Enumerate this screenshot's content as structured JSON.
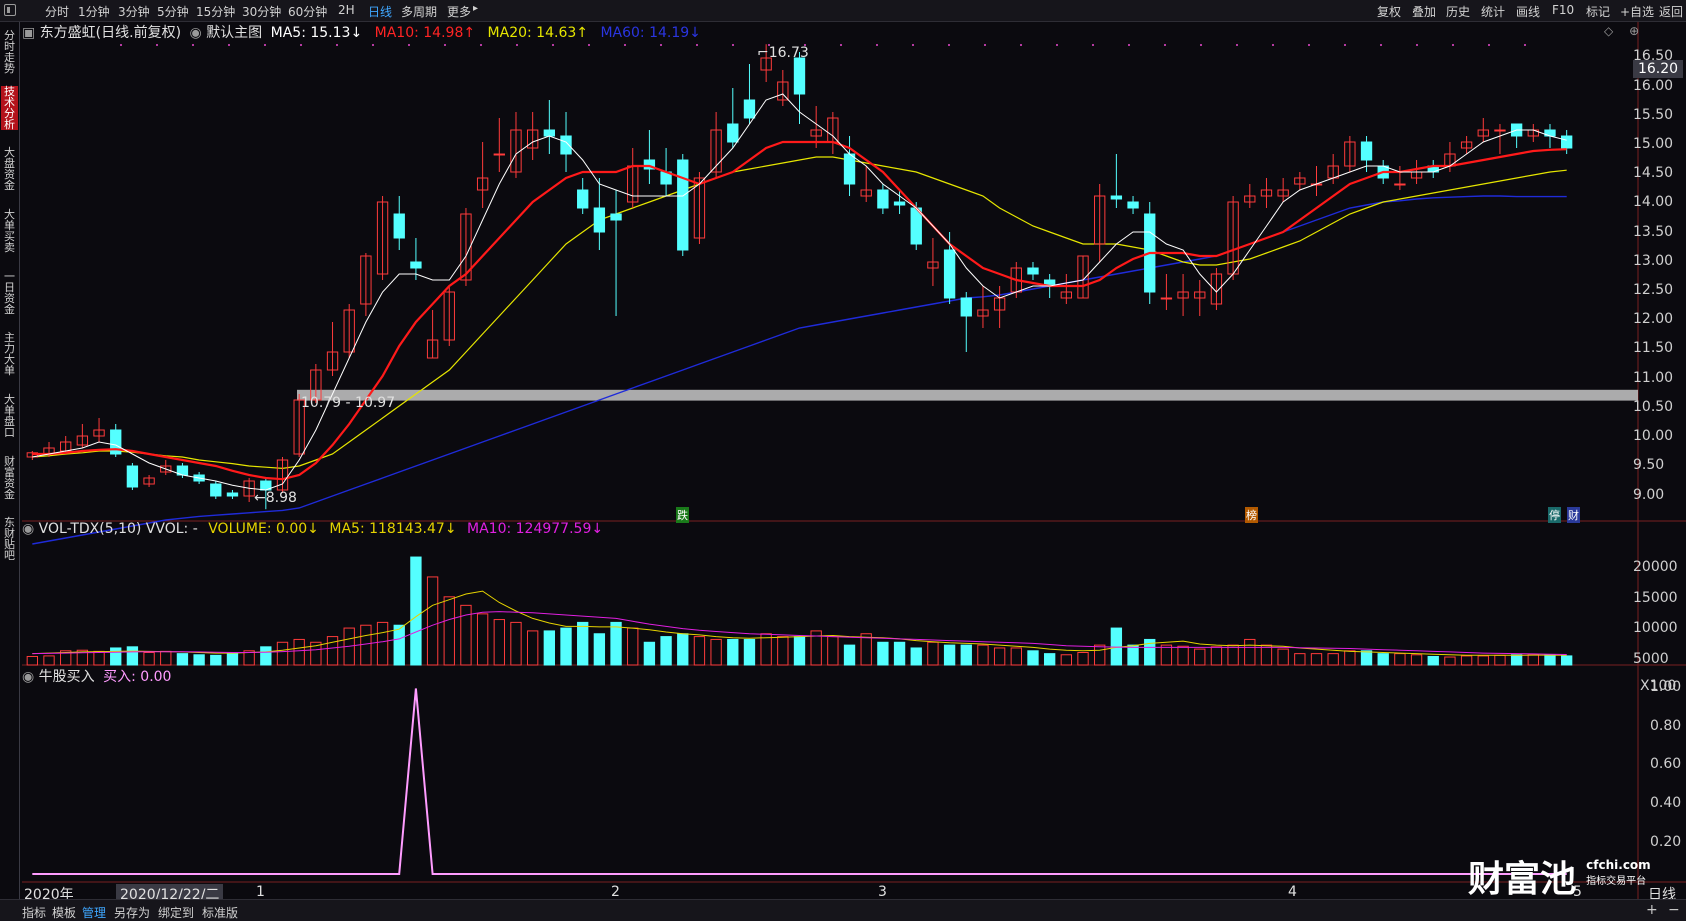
{
  "toolbar": {
    "timeframes": [
      "分时",
      "1分钟",
      "3分钟",
      "5分钟",
      "15分钟",
      "30分钟",
      "60分钟",
      "2H",
      "日线",
      "多周期",
      "更多"
    ],
    "active": "日线",
    "right": [
      "复权",
      "叠加",
      "历史",
      "统计",
      "画线",
      "F10",
      "标记",
      "+自选",
      "返回"
    ]
  },
  "sidebar": [
    {
      "label": "分时走势",
      "active": false
    },
    {
      "label": "技术分析",
      "active": true
    },
    {
      "label": "大盘资金",
      "active": false
    },
    {
      "label": "大单买卖",
      "active": false
    },
    {
      "label": "一日资金",
      "active": false
    },
    {
      "label": "主力大单",
      "active": false
    },
    {
      "label": "大单盘口",
      "active": false
    },
    {
      "label": "财富资金",
      "active": false
    },
    {
      "label": "东财贴吧",
      "active": false
    }
  ],
  "main_header": {
    "stock": "东方盛虹(日线.前复权)",
    "template": "默认主图",
    "ma5": "MA5: 15.13↓",
    "ma10": "MA10: 14.98↑",
    "ma20": "MA20: 14.63↑",
    "ma60": "MA60: 14.19↓"
  },
  "vol_header": {
    "name": "VOL-TDX(5,10) VVOL: -",
    "volume": "VOLUME: 0.00↓",
    "ma5": "MA5: 118143.47↓",
    "ma10": "MA10: 124977.59↓"
  },
  "ind_header": {
    "name": "牛股买入",
    "buy": "买入: 0.00"
  },
  "annotations": {
    "high": "16.73",
    "low": "8.98",
    "gap": "10.79 - 10.97",
    "current_price": "16.20",
    "markers": [
      "跌",
      "榜",
      "停",
      "财"
    ]
  },
  "y_axes": {
    "price": [
      "16.50",
      "16.00",
      "15.50",
      "15.00",
      "14.50",
      "14.00",
      "13.50",
      "13.00",
      "12.50",
      "12.00",
      "11.50",
      "11.00",
      "10.50",
      "10.00",
      "9.50",
      "9.00"
    ],
    "volume": [
      "20000",
      "15000",
      "10000",
      "5000",
      "X100"
    ],
    "indicator": [
      "1.00",
      "0.80",
      "0.60",
      "0.40",
      "0.20"
    ]
  },
  "x_axis": {
    "labels": [
      "2020年",
      "2020/12/22/二",
      "1",
      "2",
      "3",
      "4",
      "5"
    ],
    "period": "日线"
  },
  "bottom_tabs": [
    "指标",
    "模板",
    "管理",
    "另存为",
    "绑定到",
    "标准版"
  ],
  "bottom_active": "管理",
  "watermark": {
    "brand": "财富池",
    "url": "cfchi.com",
    "sub": "指标交易平台"
  },
  "colors": {
    "up": "#ff3b3b",
    "down": "#54ffff",
    "ma5": "#ffffff",
    "ma10": "#ff1a1a",
    "ma20": "#e6e600",
    "ma60": "#1f2bd9",
    "vol_ma5": "#e6d300",
    "vol_ma10": "#e020e0",
    "indicator": "#ff9cff",
    "active_tab": "#3fa7ff"
  },
  "chart_data": {
    "type": "candlestick",
    "price_range": [
      8.8,
      16.8
    ],
    "candles": [
      [
        9.85,
        9.92,
        9.8,
        9.95
      ],
      [
        9.9,
        10.0,
        9.85,
        10.1
      ],
      [
        9.95,
        10.1,
        9.9,
        10.2
      ],
      [
        10.05,
        10.2,
        10.0,
        10.4
      ],
      [
        10.2,
        10.3,
        10.1,
        10.5
      ],
      [
        10.3,
        9.9,
        9.85,
        10.4
      ],
      [
        9.7,
        9.35,
        9.3,
        9.75
      ],
      [
        9.4,
        9.5,
        9.35,
        9.55
      ],
      [
        9.6,
        9.7,
        9.55,
        9.8
      ],
      [
        9.7,
        9.55,
        9.5,
        9.75
      ],
      [
        9.55,
        9.45,
        9.4,
        9.6
      ],
      [
        9.4,
        9.2,
        9.15,
        9.45
      ],
      [
        9.25,
        9.2,
        9.15,
        9.3
      ],
      [
        9.2,
        9.45,
        9.1,
        9.5
      ],
      [
        9.45,
        9.3,
        8.98,
        9.5
      ],
      [
        9.3,
        9.8,
        9.25,
        9.85
      ],
      [
        9.9,
        10.8,
        9.85,
        10.9
      ],
      [
        10.8,
        11.3,
        10.75,
        11.4
      ],
      [
        11.3,
        11.6,
        11.2,
        12.1
      ],
      [
        11.6,
        12.3,
        11.5,
        12.4
      ],
      [
        12.4,
        13.2,
        12.2,
        13.25
      ],
      [
        12.9,
        14.1,
        12.8,
        14.2
      ],
      [
        13.9,
        13.5,
        13.3,
        14.2
      ],
      [
        13.1,
        13.0,
        12.8,
        13.5
      ],
      [
        11.5,
        11.8,
        11.5,
        12.3
      ],
      [
        11.8,
        12.6,
        11.7,
        12.7
      ],
      [
        12.8,
        13.9,
        12.7,
        14.0
      ],
      [
        14.3,
        14.5,
        14.0,
        15.1
      ],
      [
        14.9,
        14.9,
        14.6,
        15.5
      ],
      [
        14.6,
        15.3,
        14.5,
        15.6
      ],
      [
        15.0,
        15.3,
        14.8,
        15.6
      ],
      [
        15.3,
        15.2,
        14.9,
        15.8
      ],
      [
        15.2,
        14.9,
        14.6,
        15.6
      ],
      [
        14.3,
        14.0,
        13.9,
        14.5
      ],
      [
        14.0,
        13.6,
        13.3,
        14.5
      ],
      [
        13.9,
        13.8,
        12.2,
        14.3
      ],
      [
        14.1,
        14.7,
        14.0,
        15.0
      ],
      [
        14.8,
        14.65,
        14.4,
        15.3
      ],
      [
        14.6,
        14.4,
        14.2,
        15.0
      ],
      [
        14.8,
        13.3,
        13.2,
        14.9
      ],
      [
        13.5,
        14.5,
        13.4,
        14.6
      ],
      [
        14.6,
        15.3,
        14.5,
        15.6
      ],
      [
        15.4,
        15.1,
        15.0,
        16.0
      ],
      [
        15.8,
        15.5,
        15.4,
        16.4
      ],
      [
        16.3,
        16.5,
        16.1,
        16.73
      ],
      [
        15.8,
        16.1,
        15.7,
        16.3
      ],
      [
        16.5,
        15.9,
        15.4,
        16.6
      ],
      [
        15.2,
        15.3,
        15.0,
        15.7
      ],
      [
        15.1,
        15.5,
        14.9,
        15.6
      ],
      [
        14.9,
        14.4,
        14.2,
        15.2
      ],
      [
        14.2,
        14.3,
        14.1,
        14.7
      ],
      [
        14.3,
        14.0,
        13.9,
        14.4
      ],
      [
        14.1,
        14.05,
        13.9,
        14.3
      ],
      [
        14.0,
        13.4,
        13.3,
        14.1
      ],
      [
        13.0,
        13.1,
        12.7,
        13.5
      ],
      [
        13.3,
        12.5,
        12.4,
        13.6
      ],
      [
        12.5,
        12.2,
        11.6,
        12.6
      ],
      [
        12.2,
        12.3,
        12.0,
        12.7
      ],
      [
        12.3,
        12.5,
        12.0,
        12.7
      ],
      [
        12.6,
        13.0,
        12.5,
        13.1
      ],
      [
        13.0,
        12.9,
        12.8,
        13.1
      ],
      [
        12.8,
        12.7,
        12.5,
        12.9
      ],
      [
        12.5,
        12.6,
        12.4,
        12.9
      ],
      [
        12.5,
        13.2,
        12.5,
        13.2
      ],
      [
        13.4,
        14.2,
        13.1,
        14.4
      ],
      [
        14.2,
        14.15,
        14.0,
        14.9
      ],
      [
        14.1,
        14.0,
        13.9,
        14.2
      ],
      [
        13.9,
        12.6,
        12.4,
        14.1
      ],
      [
        12.5,
        12.5,
        12.3,
        12.9
      ],
      [
        12.5,
        12.6,
        12.2,
        12.9
      ],
      [
        12.5,
        12.6,
        12.2,
        12.8
      ],
      [
        12.4,
        12.9,
        12.3,
        13.0
      ],
      [
        12.9,
        14.1,
        12.8,
        14.2
      ],
      [
        14.1,
        14.2,
        14.0,
        14.4
      ],
      [
        14.2,
        14.3,
        14.0,
        14.5
      ],
      [
        14.2,
        14.3,
        14.1,
        14.5
      ],
      [
        14.4,
        14.5,
        14.3,
        14.6
      ],
      [
        14.4,
        14.4,
        14.2,
        14.7
      ],
      [
        14.5,
        14.7,
        14.4,
        14.9
      ],
      [
        14.7,
        15.1,
        14.6,
        15.2
      ],
      [
        15.1,
        14.8,
        14.6,
        15.2
      ],
      [
        14.7,
        14.5,
        14.4,
        14.8
      ],
      [
        14.4,
        14.4,
        14.3,
        14.7
      ],
      [
        14.5,
        14.6,
        14.4,
        14.8
      ],
      [
        14.7,
        14.6,
        14.5,
        14.8
      ],
      [
        14.7,
        14.9,
        14.6,
        15.1
      ],
      [
        15.0,
        15.1,
        14.9,
        15.2
      ],
      [
        15.2,
        15.3,
        15.1,
        15.5
      ],
      [
        15.3,
        15.3,
        14.9,
        15.4
      ],
      [
        15.4,
        15.2,
        15.0,
        15.4
      ],
      [
        15.2,
        15.3,
        15.1,
        15.4
      ],
      [
        15.3,
        15.2,
        15.0,
        15.4
      ],
      [
        15.2,
        15.0,
        14.9,
        15.3
      ]
    ],
    "ma5": [
      9.85,
      9.9,
      9.95,
      10.0,
      10.1,
      10.05,
      9.9,
      9.75,
      9.65,
      9.55,
      9.5,
      9.45,
      9.38,
      9.33,
      9.3,
      9.4,
      9.8,
      10.3,
      10.9,
      11.5,
      12.1,
      12.6,
      12.9,
      12.9,
      12.8,
      12.8,
      13.2,
      13.8,
      14.4,
      14.9,
      15.1,
      15.2,
      15.1,
      14.8,
      14.4,
      14.3,
      14.2,
      14.2,
      14.2,
      14.2,
      14.4,
      14.7,
      15.0,
      15.4,
      15.8,
      15.9,
      15.6,
      15.4,
      15.2,
      14.9,
      14.7,
      14.4,
      14.2,
      14.0,
      13.7,
      13.4,
      13.0,
      12.7,
      12.5,
      12.6,
      12.7,
      12.7,
      12.75,
      12.8,
      13.1,
      13.4,
      13.6,
      13.6,
      13.4,
      13.3,
      12.9,
      12.6,
      12.9,
      13.3,
      13.7,
      14.1,
      14.3,
      14.4,
      14.5,
      14.6,
      14.7,
      14.7,
      14.6,
      14.6,
      14.6,
      14.7,
      14.9,
      15.1,
      15.2,
      15.3,
      15.3,
      15.2,
      15.13
    ],
    "ma10": [
      9.9,
      9.9,
      9.92,
      9.95,
      9.97,
      9.98,
      9.95,
      9.9,
      9.85,
      9.8,
      9.75,
      9.7,
      9.62,
      9.55,
      9.5,
      9.48,
      9.55,
      9.75,
      10.05,
      10.4,
      10.8,
      11.2,
      11.7,
      12.1,
      12.4,
      12.7,
      12.9,
      13.2,
      13.5,
      13.8,
      14.1,
      14.3,
      14.5,
      14.6,
      14.6,
      14.6,
      14.7,
      14.7,
      14.6,
      14.5,
      14.4,
      14.5,
      14.6,
      14.8,
      15.0,
      15.1,
      15.1,
      15.1,
      15.1,
      15.0,
      14.8,
      14.6,
      14.3,
      14.0,
      13.7,
      13.4,
      13.2,
      13.0,
      12.9,
      12.8,
      12.75,
      12.7,
      12.7,
      12.7,
      12.8,
      13.0,
      13.15,
      13.25,
      13.25,
      13.25,
      13.2,
      13.2,
      13.3,
      13.4,
      13.5,
      13.6,
      13.8,
      14.0,
      14.2,
      14.4,
      14.5,
      14.6,
      14.6,
      14.65,
      14.7,
      14.7,
      14.75,
      14.8,
      14.85,
      14.9,
      14.95,
      14.97,
      14.98
    ],
    "ma20": [
      9.85,
      9.87,
      9.9,
      9.92,
      9.95,
      9.95,
      9.93,
      9.9,
      9.87,
      9.85,
      9.8,
      9.77,
      9.74,
      9.7,
      9.68,
      9.66,
      9.7,
      9.8,
      9.9,
      10.1,
      10.3,
      10.5,
      10.7,
      10.9,
      11.1,
      11.3,
      11.6,
      11.9,
      12.2,
      12.5,
      12.8,
      13.1,
      13.4,
      13.6,
      13.8,
      13.9,
      14.0,
      14.1,
      14.2,
      14.3,
      14.4,
      14.5,
      14.6,
      14.65,
      14.7,
      14.75,
      14.8,
      14.85,
      14.85,
      14.8,
      14.75,
      14.7,
      14.65,
      14.6,
      14.5,
      14.4,
      14.3,
      14.2,
      14.0,
      13.85,
      13.7,
      13.6,
      13.5,
      13.4,
      13.4,
      13.4,
      13.35,
      13.3,
      13.2,
      13.1,
      13.05,
      13.05,
      13.1,
      13.15,
      13.25,
      13.35,
      13.45,
      13.6,
      13.75,
      13.9,
      14.0,
      14.1,
      14.15,
      14.2,
      14.25,
      14.3,
      14.35,
      14.4,
      14.45,
      14.5,
      14.55,
      14.6,
      14.63
    ],
    "ma60": [
      8.4,
      8.45,
      8.5,
      8.55,
      8.6,
      8.65,
      8.7,
      8.75,
      8.8,
      8.83,
      8.86,
      8.88,
      8.9,
      8.92,
      8.94,
      8.96,
      9.0,
      9.1,
      9.2,
      9.3,
      9.4,
      9.5,
      9.6,
      9.7,
      9.8,
      9.9,
      10.0,
      10.1,
      10.2,
      10.3,
      10.4,
      10.5,
      10.6,
      10.7,
      10.8,
      10.9,
      11.0,
      11.1,
      11.2,
      11.3,
      11.4,
      11.5,
      11.6,
      11.7,
      11.8,
      11.9,
      12.0,
      12.05,
      12.1,
      12.15,
      12.2,
      12.25,
      12.3,
      12.35,
      12.4,
      12.45,
      12.5,
      12.52,
      12.55,
      12.6,
      12.65,
      12.7,
      12.75,
      12.8,
      12.85,
      12.9,
      12.95,
      13.0,
      13.05,
      13.1,
      13.15,
      13.2,
      13.3,
      13.4,
      13.5,
      13.6,
      13.7,
      13.8,
      13.9,
      14.0,
      14.05,
      14.1,
      14.12,
      14.15,
      14.17,
      14.18,
      14.19,
      14.2,
      14.2,
      14.19,
      14.19,
      14.19,
      14.19
    ],
    "volume_range": [
      0,
      22000
    ],
    "volume": [
      1500,
      1600,
      2500,
      2600,
      2400,
      3000,
      3200,
      2200,
      2400,
      2000,
      1800,
      1700,
      2200,
      2500,
      3200,
      4000,
      4500,
      4000,
      5000,
      6500,
      7000,
      7500,
      7000,
      19000,
      15500,
      12000,
      10500,
      9000,
      8000,
      7500,
      6000,
      6000,
      6500,
      7500,
      5500,
      7500,
      6500,
      4000,
      5000,
      5500,
      5000,
      4500,
      4500,
      4500,
      5500,
      5000,
      5000,
      6000,
      5000,
      3500,
      5500,
      4000,
      4000,
      3000,
      4000,
      3500,
      3500,
      3500,
      3000,
      3000,
      2500,
      2000,
      1800,
      2200,
      3500,
      6500,
      3500,
      4500,
      3500,
      3300,
      2800,
      3200,
      3500,
      4500,
      3500,
      2800,
      2000,
      2000,
      2000,
      2500,
      2500,
      2000,
      2000,
      1800,
      1500,
      1400,
      1600,
      1600,
      1700,
      1800,
      1800,
      1800,
      1600
    ],
    "vol_ma5": [
      2000,
      2100,
      2200,
      2300,
      2350,
      2400,
      2450,
      2400,
      2350,
      2300,
      2200,
      2100,
      2100,
      2200,
      2300,
      2600,
      3000,
      3400,
      4000,
      4600,
      5200,
      5700,
      6300,
      8500,
      10500,
      11500,
      12500,
      13000,
      11000,
      9500,
      8200,
      7400,
      6800,
      6800,
      6700,
      6700,
      6500,
      6200,
      5800,
      5500,
      5300,
      5000,
      4800,
      4700,
      4800,
      4900,
      5000,
      5100,
      5200,
      5000,
      4900,
      4800,
      4600,
      4300,
      4100,
      3900,
      3800,
      3700,
      3500,
      3300,
      3100,
      2800,
      2600,
      2500,
      2600,
      3100,
      3400,
      3800,
      4000,
      4200,
      3700,
      3500,
      3400,
      3500,
      3400,
      3300,
      3000,
      2800,
      2600,
      2400,
      2300,
      2200,
      2100,
      2000,
      1900,
      1800,
      1700,
      1700,
      1700,
      1700,
      1750,
      1750,
      1700
    ],
    "vol_ma10": [
      2000,
      2050,
      2100,
      2150,
      2200,
      2250,
      2300,
      2320,
      2340,
      2330,
      2300,
      2250,
      2200,
      2200,
      2250,
      2350,
      2500,
      2700,
      3000,
      3300,
      3700,
      4100,
      4600,
      5800,
      7000,
      8000,
      8800,
      9300,
      9400,
      9300,
      9200,
      9000,
      8800,
      8600,
      8400,
      8200,
      7700,
      7200,
      6800,
      6400,
      6100,
      5900,
      5700,
      5500,
      5400,
      5300,
      5200,
      5100,
      5000,
      4900,
      4800,
      4700,
      4600,
      4500,
      4400,
      4300,
      4200,
      4100,
      4000,
      3900,
      3800,
      3600,
      3400,
      3300,
      3200,
      3150,
      3100,
      3100,
      3100,
      3100,
      3100,
      3100,
      3100,
      3100,
      3100,
      3100,
      3050,
      3000,
      2950,
      2900,
      2800,
      2700,
      2600,
      2500,
      2400,
      2300,
      2200,
      2100,
      2050,
      2000,
      1950,
      1900,
      1850
    ],
    "buy_signal": {
      "index": 23,
      "value": 1.0,
      "range": [
        0,
        1.1
      ]
    }
  }
}
